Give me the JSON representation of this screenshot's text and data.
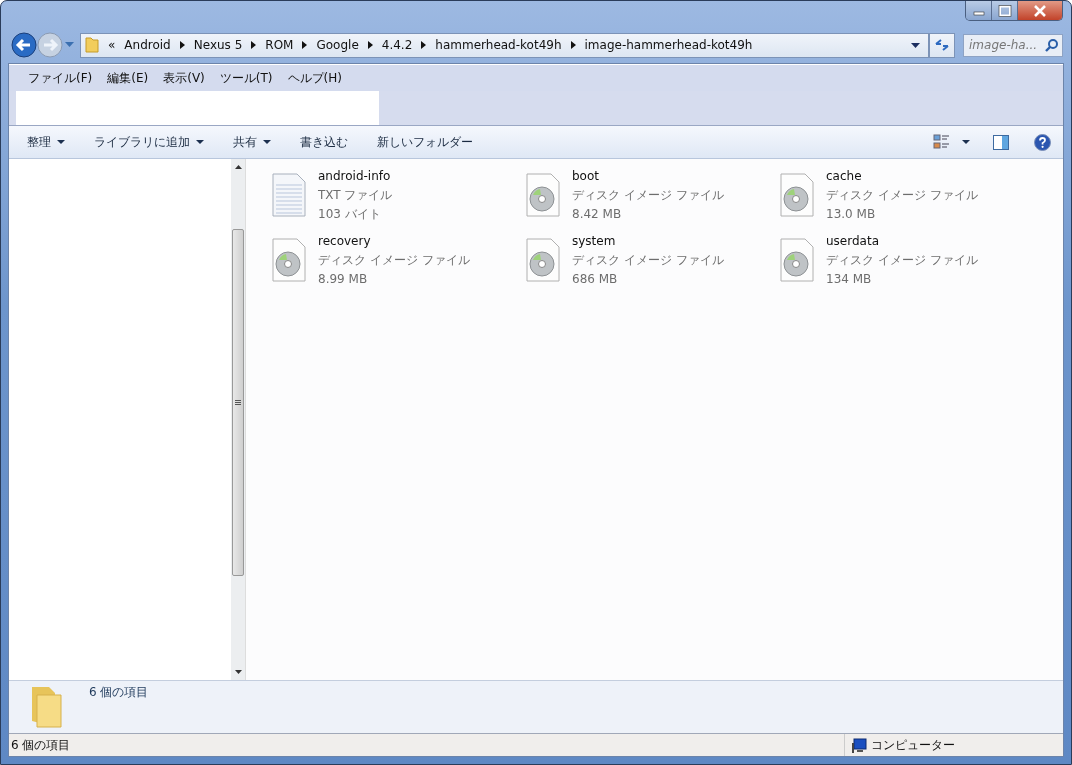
{
  "address_bar": {
    "overflow": "«",
    "crumbs": [
      "Android",
      "Nexus 5",
      "ROM",
      "Google",
      "4.4.2",
      "hammerhead-kot49h",
      "image-hammerhead-kot49h"
    ]
  },
  "search": {
    "placeholder": "image-ha..."
  },
  "menu_bar": [
    "ファイル(F)",
    "編集(E)",
    "表示(V)",
    "ツール(T)",
    "ヘルプ(H)"
  ],
  "toolbar": [
    {
      "label": "整理",
      "has_menu": true
    },
    {
      "label": "ライブラリに追加",
      "has_menu": true
    },
    {
      "label": "共有",
      "has_menu": true
    },
    {
      "label": "書き込む",
      "has_menu": false
    },
    {
      "label": "新しいフォルダー",
      "has_menu": false
    }
  ],
  "files": [
    {
      "name": "android-info",
      "type": "TXT ファイル",
      "size": "103 バイト",
      "kind": "text"
    },
    {
      "name": "boot",
      "type": "ディスク イメージ ファイル",
      "size": "8.42 MB",
      "kind": "disc"
    },
    {
      "name": "cache",
      "type": "ディスク イメージ ファイル",
      "size": "13.0 MB",
      "kind": "disc"
    },
    {
      "name": "recovery",
      "type": "ディスク イメージ ファイル",
      "size": "8.99 MB",
      "kind": "disc"
    },
    {
      "name": "system",
      "type": "ディスク イメージ ファイル",
      "size": "686 MB",
      "kind": "disc"
    },
    {
      "name": "userdata",
      "type": "ディスク イメージ ファイル",
      "size": "134 MB",
      "kind": "disc"
    }
  ],
  "details_pane": {
    "summary": "6 個の項目"
  },
  "status_bar": {
    "count": "6 個の項目",
    "zone": "コンピューター"
  }
}
